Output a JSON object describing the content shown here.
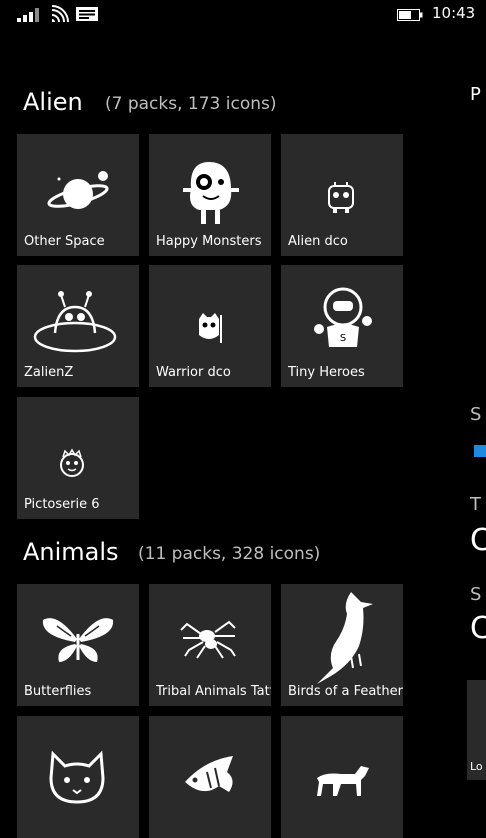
{
  "status_bar": {
    "time": "10:43"
  },
  "sections": [
    {
      "title": "Alien",
      "subtitle": "(7 packs, 173 icons)",
      "tiles": [
        {
          "label": "Other Space",
          "icon": "planet-icon"
        },
        {
          "label": "Happy Monsters",
          "icon": "monster-icon"
        },
        {
          "label": "Alien dco",
          "icon": "alien-robot-icon"
        },
        {
          "label": "ZalienZ",
          "icon": "ufo-alien-icon"
        },
        {
          "label": "Warrior dco",
          "icon": "warrior-icon"
        },
        {
          "label": "Tiny Heroes",
          "icon": "astronaut-hero-icon"
        },
        {
          "label": "Pictoserie 6",
          "icon": "alien-face-icon"
        }
      ]
    },
    {
      "title": "Animals",
      "subtitle": "(11 packs, 328 icons)",
      "tiles": [
        {
          "label": "Butterflies",
          "icon": "butterfly-icon"
        },
        {
          "label": "Tribal Animals Tatt",
          "icon": "spider-icon"
        },
        {
          "label": "Birds of a Feather",
          "icon": "bird-icon"
        },
        {
          "label": "",
          "icon": "cat-icon"
        },
        {
          "label": "",
          "icon": "fish-icon"
        },
        {
          "label": "",
          "icon": "horse-icon"
        }
      ]
    }
  ],
  "peek_panel": {
    "p_text": "P",
    "s1_text": "S",
    "t_text": "T",
    "c1_text": "C",
    "s2_text": "S",
    "c2_text": "C",
    "lo_text": "Lo"
  }
}
